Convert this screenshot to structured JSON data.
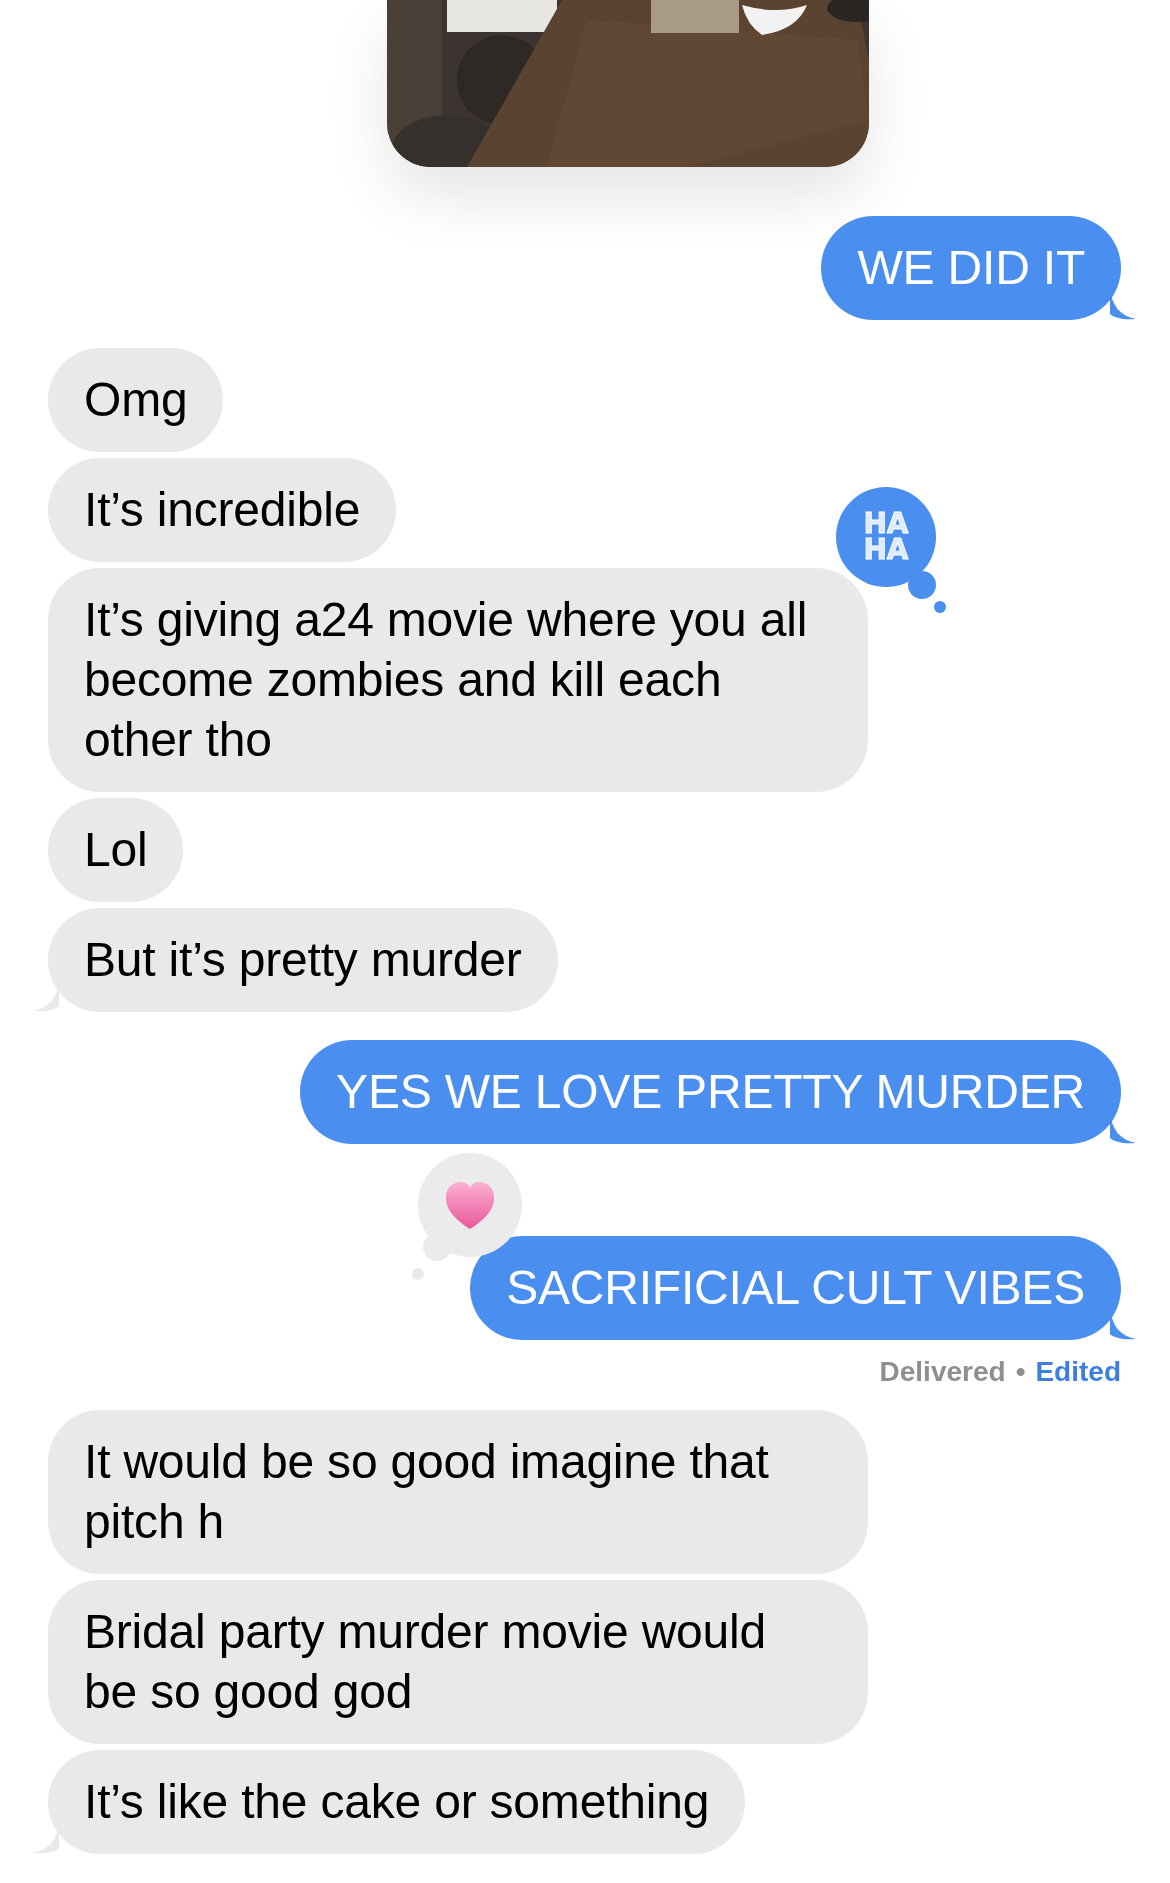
{
  "messages": [
    {
      "kind": "sent",
      "text": "WE DID IT",
      "tail": true
    },
    {
      "kind": "received",
      "text": "Omg",
      "tail": false
    },
    {
      "kind": "received",
      "text": "It’s incredible",
      "tail": false
    },
    {
      "kind": "received",
      "text": "It’s giving a24 movie where you all become zombies and kill each other tho",
      "tail": false,
      "reaction": {
        "kind": "haha",
        "lines": [
          "HA",
          "HA"
        ]
      }
    },
    {
      "kind": "received",
      "text": "Lol",
      "tail": false
    },
    {
      "kind": "received",
      "text": "But it’s pretty murder",
      "tail": true
    },
    {
      "kind": "sent",
      "text": "YES WE LOVE PRETTY MURDER",
      "tail": true
    },
    {
      "kind": "sent",
      "text": "SACRIFICIAL CULT VIBES",
      "tail": true,
      "reaction": {
        "kind": "heart"
      }
    },
    {
      "kind": "status",
      "delivered": "Delivered",
      "separator": "•",
      "edited": "Edited"
    },
    {
      "kind": "received",
      "text": "It would be so good imagine that pitch h",
      "tail": false
    },
    {
      "kind": "received",
      "text": "Bridal party murder movie would be so good god",
      "tail": false
    },
    {
      "kind": "received",
      "text": "It’s like the cake or something",
      "tail": true
    }
  ]
}
